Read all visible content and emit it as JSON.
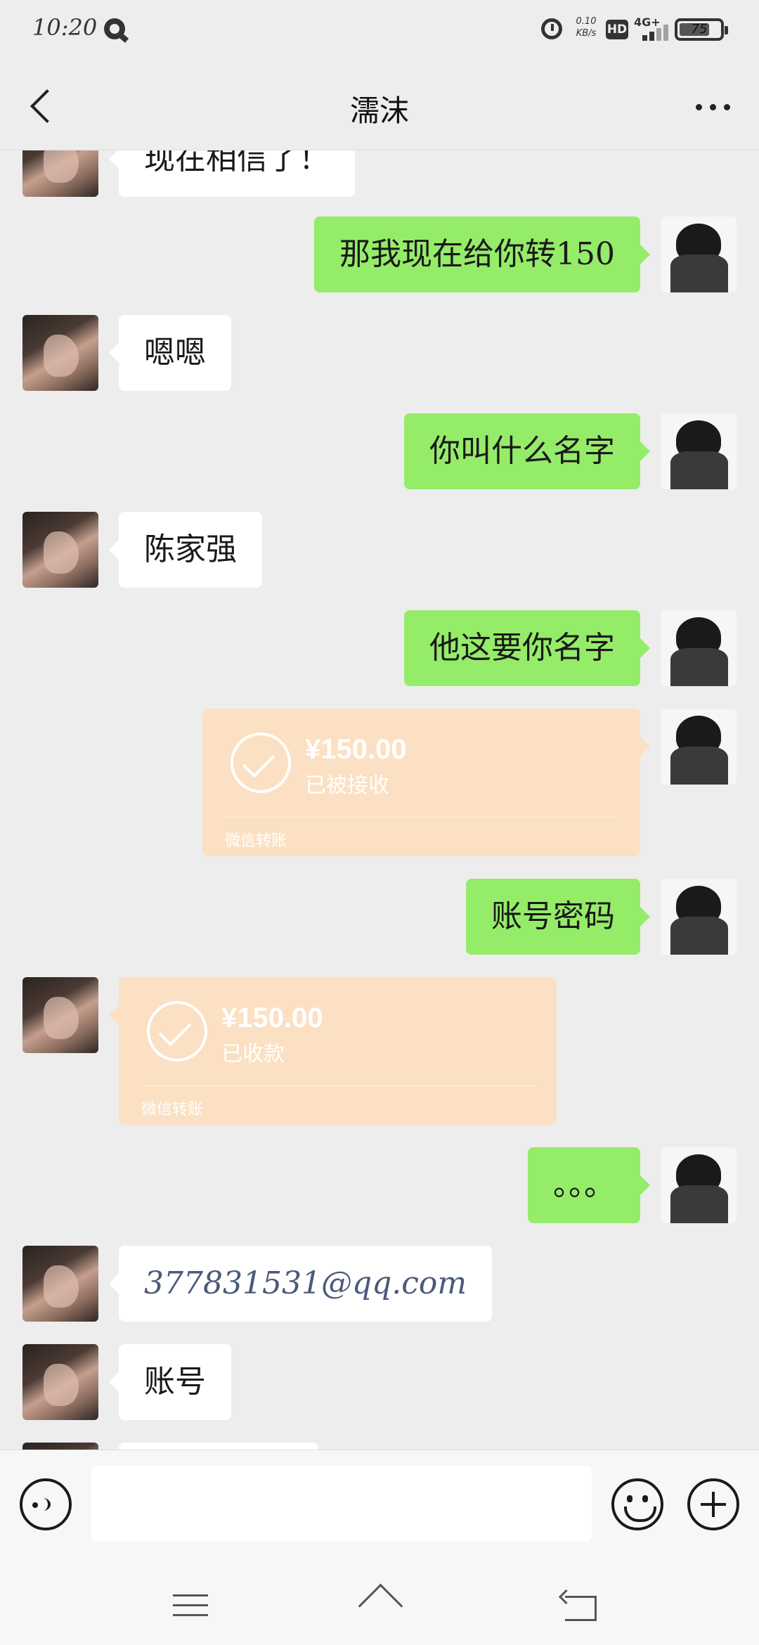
{
  "status_bar": {
    "time": "10:20",
    "net_speed_value": "0.10",
    "net_speed_unit": "KB/s",
    "hd_label": "HD",
    "network": "4G+",
    "battery": "75",
    "icons": [
      "q-app-icon",
      "alarm-icon",
      "hd-icon",
      "signal-icon",
      "battery-icon"
    ]
  },
  "header": {
    "title": "濡沫",
    "back_icon": "chevron-left-icon",
    "more_icon": "more-icon"
  },
  "messages": [
    {
      "side": "left",
      "type": "text",
      "text": "现在相信了！"
    },
    {
      "side": "right",
      "type": "text",
      "text": "那我现在给你转150"
    },
    {
      "side": "left",
      "type": "text",
      "text": "嗯嗯"
    },
    {
      "side": "right",
      "type": "text",
      "text": "你叫什么名字"
    },
    {
      "side": "left",
      "type": "text",
      "text": "陈家强"
    },
    {
      "side": "right",
      "type": "text",
      "text": "他这要你名字"
    },
    {
      "side": "right",
      "type": "transfer",
      "amount": "¥150.00",
      "status": "已被接收",
      "footer": "微信转账"
    },
    {
      "side": "right",
      "type": "text",
      "text": "账号密码"
    },
    {
      "side": "left",
      "type": "transfer",
      "amount": "¥150.00",
      "status": "已收款",
      "footer": "微信转账"
    },
    {
      "side": "right",
      "type": "text",
      "text": "。。。"
    },
    {
      "side": "left",
      "type": "text",
      "text": "377831531@qq.com"
    },
    {
      "side": "left",
      "type": "text",
      "text": "账号"
    }
  ],
  "input_bar": {
    "placeholder": "",
    "icons": [
      "voice-icon",
      "emoji-icon",
      "plus-icon"
    ]
  },
  "system_nav": {
    "icons": [
      "menu-icon",
      "home-icon",
      "back-icon"
    ]
  },
  "colors": {
    "background": "#ededed",
    "outgoing_bubble": "#95ec69",
    "incoming_bubble": "#ffffff",
    "transfer_card": "#fbe0c3"
  }
}
